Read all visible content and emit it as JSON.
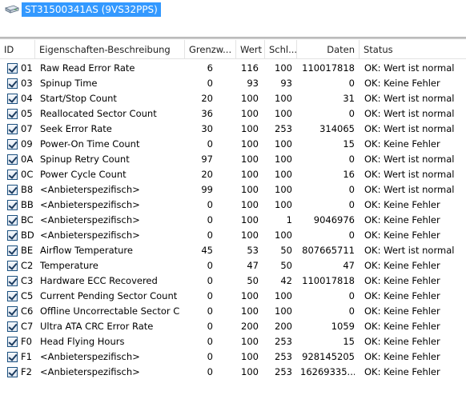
{
  "drive": {
    "label": "ST31500341AS (9VS32PPS)",
    "icon": "hard-drive-icon"
  },
  "columns": {
    "id": "ID",
    "description": "Eigenschaften-Beschreibung",
    "threshold": "Grenzw...",
    "value": "Wert",
    "worst": "Schl...",
    "data": "Daten",
    "status": "Status"
  },
  "rows": [
    {
      "id": "01",
      "desc": "Raw Read Error Rate",
      "thr": "6",
      "val": "116",
      "wst": "100",
      "data": "110017818",
      "status": "OK: Wert ist normal",
      "checked": true
    },
    {
      "id": "03",
      "desc": "Spinup Time",
      "thr": "0",
      "val": "93",
      "wst": "93",
      "data": "0",
      "status": "OK: Keine Fehler",
      "checked": true
    },
    {
      "id": "04",
      "desc": "Start/Stop Count",
      "thr": "20",
      "val": "100",
      "wst": "100",
      "data": "31",
      "status": "OK: Wert ist normal",
      "checked": true
    },
    {
      "id": "05",
      "desc": "Reallocated Sector Count",
      "thr": "36",
      "val": "100",
      "wst": "100",
      "data": "0",
      "status": "OK: Wert ist normal",
      "checked": true
    },
    {
      "id": "07",
      "desc": "Seek Error Rate",
      "thr": "30",
      "val": "100",
      "wst": "253",
      "data": "314065",
      "status": "OK: Wert ist normal",
      "checked": true
    },
    {
      "id": "09",
      "desc": "Power-On Time Count",
      "thr": "0",
      "val": "100",
      "wst": "100",
      "data": "15",
      "status": "OK: Keine Fehler",
      "checked": true
    },
    {
      "id": "0A",
      "desc": "Spinup Retry Count",
      "thr": "97",
      "val": "100",
      "wst": "100",
      "data": "0",
      "status": "OK: Wert ist normal",
      "checked": true
    },
    {
      "id": "0C",
      "desc": "Power Cycle Count",
      "thr": "20",
      "val": "100",
      "wst": "100",
      "data": "16",
      "status": "OK: Wert ist normal",
      "checked": true
    },
    {
      "id": "B8",
      "desc": "<Anbieterspezifisch>",
      "thr": "99",
      "val": "100",
      "wst": "100",
      "data": "0",
      "status": "OK: Wert ist normal",
      "checked": true
    },
    {
      "id": "BB",
      "desc": "<Anbieterspezifisch>",
      "thr": "0",
      "val": "100",
      "wst": "100",
      "data": "0",
      "status": "OK: Keine Fehler",
      "checked": true
    },
    {
      "id": "BC",
      "desc": "<Anbieterspezifisch>",
      "thr": "0",
      "val": "100",
      "wst": "1",
      "data": "9046976",
      "status": "OK: Keine Fehler",
      "checked": true
    },
    {
      "id": "BD",
      "desc": "<Anbieterspezifisch>",
      "thr": "0",
      "val": "100",
      "wst": "100",
      "data": "0",
      "status": "OK: Keine Fehler",
      "checked": true
    },
    {
      "id": "BE",
      "desc": "Airflow Temperature",
      "thr": "45",
      "val": "53",
      "wst": "50",
      "data": "807665711",
      "status": "OK: Wert ist normal",
      "checked": true
    },
    {
      "id": "C2",
      "desc": "Temperature",
      "thr": "0",
      "val": "47",
      "wst": "50",
      "data": "47",
      "status": "OK: Keine Fehler",
      "checked": true
    },
    {
      "id": "C3",
      "desc": "Hardware ECC Recovered",
      "thr": "0",
      "val": "50",
      "wst": "42",
      "data": "110017818",
      "status": "OK: Keine Fehler",
      "checked": true
    },
    {
      "id": "C5",
      "desc": "Current Pending Sector Count",
      "thr": "0",
      "val": "100",
      "wst": "100",
      "data": "0",
      "status": "OK: Keine Fehler",
      "checked": true
    },
    {
      "id": "C6",
      "desc": "Offline Uncorrectable Sector C...",
      "thr": "0",
      "val": "100",
      "wst": "100",
      "data": "0",
      "status": "OK: Keine Fehler",
      "checked": true
    },
    {
      "id": "C7",
      "desc": "Ultra ATA CRC Error Rate",
      "thr": "0",
      "val": "200",
      "wst": "200",
      "data": "1059",
      "status": "OK: Keine Fehler",
      "checked": true
    },
    {
      "id": "F0",
      "desc": "Head Flying Hours",
      "thr": "0",
      "val": "100",
      "wst": "253",
      "data": "15",
      "status": "OK: Keine Fehler",
      "checked": true
    },
    {
      "id": "F1",
      "desc": "<Anbieterspezifisch>",
      "thr": "0",
      "val": "100",
      "wst": "253",
      "data": "928145205",
      "status": "OK: Keine Fehler",
      "checked": true
    },
    {
      "id": "F2",
      "desc": "<Anbieterspezifisch>",
      "thr": "0",
      "val": "100",
      "wst": "253",
      "data": "16269335...",
      "status": "OK: Keine Fehler",
      "checked": true
    }
  ]
}
